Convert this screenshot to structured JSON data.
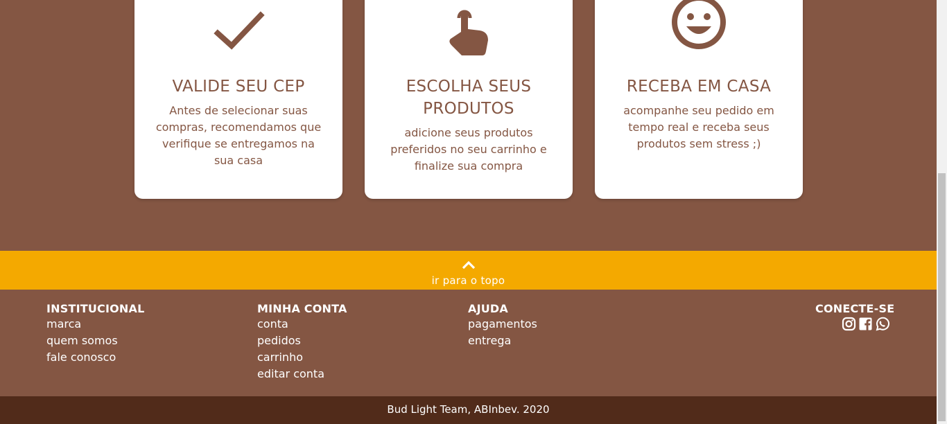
{
  "cards": [
    {
      "icon": "check-icon",
      "title": "VALIDE SEU CEP",
      "description": "Antes de selecionar suas compras, recomendamos que verifique se entregamos na sua casa"
    },
    {
      "icon": "pointer-hand-icon",
      "title": "ESCOLHA SEUS PRODUTOS",
      "description": "adicione seus produtos preferidos no seu carrinho e finalize sua compra"
    },
    {
      "icon": "smiley-icon",
      "title": "RECEBA EM CASA",
      "description": "acompanhe seu pedido em tempo real e receba seus produtos sem stress ;)"
    }
  ],
  "back_to_top": {
    "icon": "chevron-up-icon",
    "label": "ir para o topo"
  },
  "footer": {
    "institucional": {
      "heading": "INSTITUCIONAL",
      "links": [
        "marca",
        "quem somos",
        "fale conosco"
      ]
    },
    "minha_conta": {
      "heading": "MINHA CONTA",
      "links": [
        "conta",
        "pedidos",
        "carrinho",
        "editar conta"
      ]
    },
    "ajuda": {
      "heading": "AJUDA",
      "links": [
        "pagamentos",
        "entrega"
      ]
    },
    "conecte": {
      "heading": "CONECTE-SE",
      "icons": [
        "instagram-icon",
        "facebook-icon",
        "whatsapp-icon"
      ]
    },
    "copyright": "Bud Light Team, ABInbev. 2020"
  },
  "colors": {
    "brown": "#845643",
    "dark_brown": "#512b1a",
    "yellow": "#f4a900",
    "white": "#ffffff"
  }
}
